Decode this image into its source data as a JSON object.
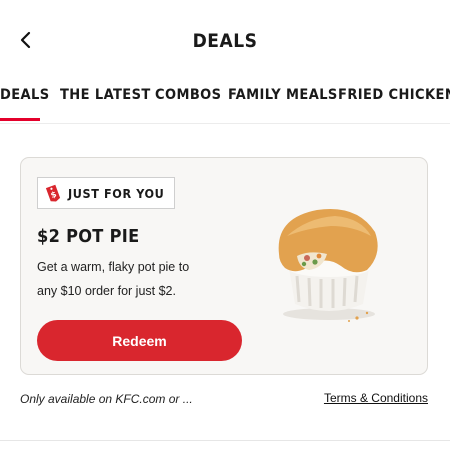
{
  "header": {
    "title": "DEALS",
    "back_icon": "chevron-left-icon"
  },
  "tabs": [
    {
      "label": "DEALS",
      "active": true
    },
    {
      "label": "THE LATEST",
      "active": false
    },
    {
      "label": "COMBOS",
      "active": false
    },
    {
      "label": "FAMILY MEALS",
      "active": false
    },
    {
      "label": "FRIED CHICKEN",
      "active": false
    }
  ],
  "deal_card": {
    "badge_icon": "price-tag-icon",
    "badge_icon_text": "$",
    "badge_label": "JUST FOR YOU",
    "title": "$2 POT PIE",
    "description_line1": "Get a warm, flaky pot pie to",
    "description_line2": "any $10 order for just $2.",
    "redeem_label": "Redeem"
  },
  "footer": {
    "availability": "Only available on KFC.com or ...",
    "terms_label": "Terms & Conditions"
  },
  "colors": {
    "accent": "#e4002b",
    "button": "#d9262e",
    "card_bg": "#f8f7f5"
  }
}
